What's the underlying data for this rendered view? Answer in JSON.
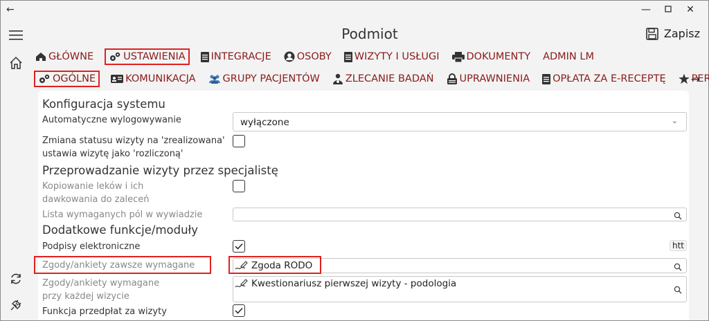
{
  "window": {
    "title": "Podmiot",
    "save_label": "Zapisz"
  },
  "main_tabs": [
    {
      "label": "GŁÓWNE",
      "icon": "home-icon"
    },
    {
      "label": "USTAWIENIA",
      "icon": "gears-icon",
      "active": true
    },
    {
      "label": "INTEGRACJE",
      "icon": "document-icon"
    },
    {
      "label": "OSOBY",
      "icon": "person-icon"
    },
    {
      "label": "WIZYTY I USŁUGI",
      "icon": "document-icon"
    },
    {
      "label": "DOKUMENTY",
      "icon": "printer-icon"
    },
    {
      "label": "ADMIN LM",
      "icon": ""
    }
  ],
  "sub_tabs": [
    {
      "label": "OGÓLNE",
      "icon": "gears-icon",
      "active": true
    },
    {
      "label": "KOMUNIKACJA",
      "icon": "contacts-icon"
    },
    {
      "label": "GRUPY PACJENTÓW",
      "icon": "group-icon"
    },
    {
      "label": "ZLECANIE BADAŃ",
      "icon": "doctor-icon"
    },
    {
      "label": "UPRAWNIENIA",
      "icon": "lock-icon"
    },
    {
      "label": "OPŁATA ZA E-RECEPTĘ",
      "icon": "document-icon"
    },
    {
      "label": "PER...",
      "icon": "star-icon"
    }
  ],
  "settings": {
    "section1": "Konfiguracja systemu",
    "auto_logout_label": "Automatyczne wylogowywanie",
    "auto_logout_value": "wyłączone",
    "status_change_label_1": "Zmiana statusu wizyty na 'zrealizowana'",
    "status_change_label_2": "ustawia wizytę jako 'rozliczoną'",
    "section2": "Przeprowadzanie wizyty przez specjalistę",
    "copy_meds_label_1": "Kopiowanie leków i ich",
    "copy_meds_label_2": "dawkowania do zaleceń",
    "required_fields_label": "Lista wymaganych pól w wywiadzie",
    "section3": "Dodatkowe funkcje/moduły",
    "e_signatures_label": "Podpisy elektroniczne",
    "consents_always_label": "Zgody/ankiety zawsze wymagane",
    "consents_always_value": "Zgoda RODO",
    "consents_each_label_1": "Zgody/ankiety wymagane",
    "consents_each_label_2": "przy każdej wizycie",
    "consents_each_value": "Kwestionariusz pierwszej wizyty - podologia",
    "prepayment_label": "Funkcja przedpłat za wizyty",
    "tooltip_fragment": "htt"
  },
  "states": {
    "status_change_checked": false,
    "copy_meds_checked": false,
    "e_signatures_checked": true,
    "prepayment_checked": true
  }
}
